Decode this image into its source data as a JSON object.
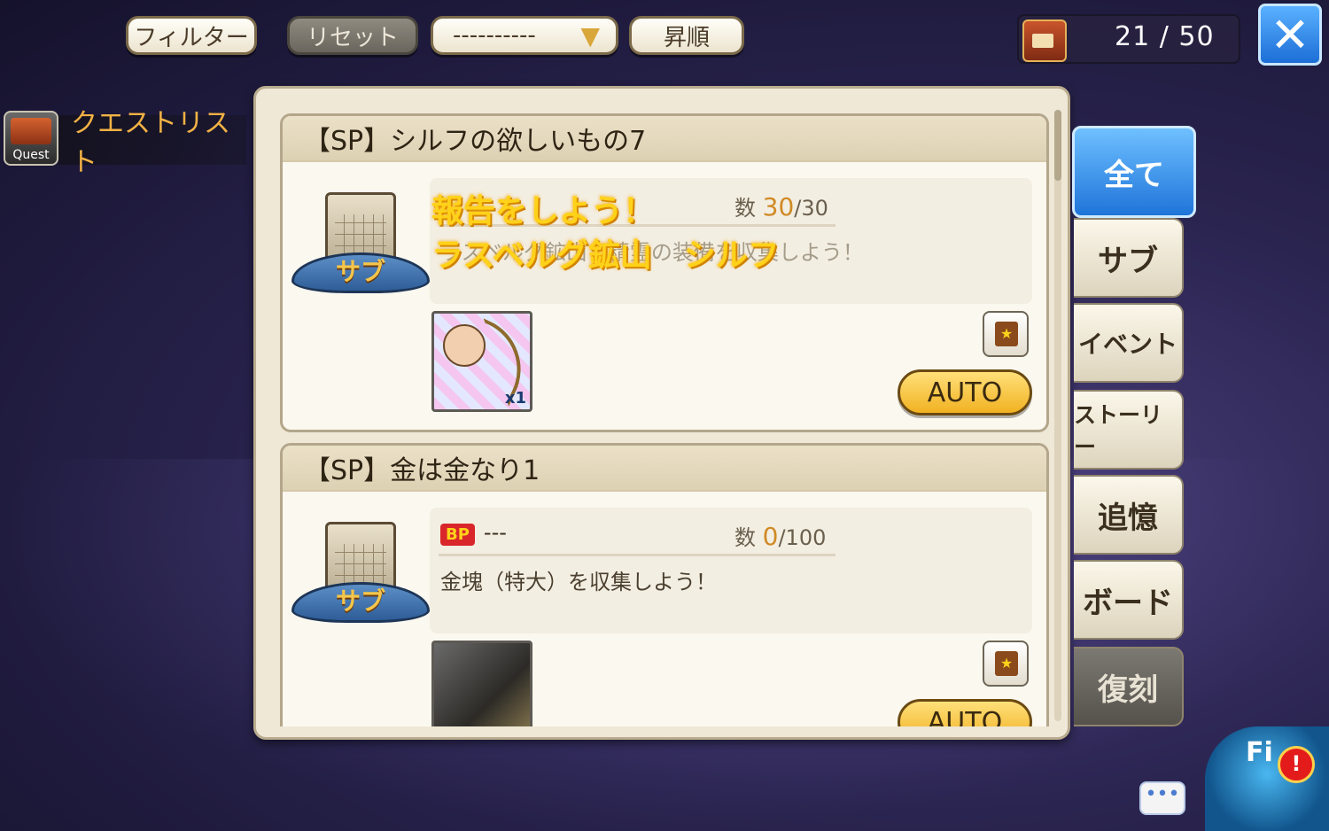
{
  "toolbar": {
    "filter_label": "フィルター",
    "reset_label": "リセット",
    "sort_select_value": "----------",
    "order_label": "昇順"
  },
  "counter": {
    "text": "21 / 50"
  },
  "close": {
    "glyph": "✕"
  },
  "sidebar": {
    "badge_text": "Quest",
    "title": "クエストリスト"
  },
  "quests": [
    {
      "title": "【SP】シルフの欲しいもの7",
      "emblem_label": "サブ",
      "info_title": "",
      "count_label": "数",
      "count_current": "30",
      "count_total": "/30",
      "description": "ラスベルグ鉱山で精霊の装備を収集しよう！",
      "overlay_line1": "報告をしよう！",
      "overlay_line2": "ラスベルグ鉱山　シルフ",
      "reward_qty": "x1",
      "auto_label": "AUTO"
    },
    {
      "title": "【SP】金は金なり1",
      "emblem_label": "サブ",
      "info_badge": "BP",
      "info_title": "---",
      "count_label": "数",
      "count_current": "0",
      "count_total": "/100",
      "description": "金塊（特大）を収集しよう！",
      "auto_label": "AUTO"
    }
  ],
  "tabs": [
    {
      "label": "全て",
      "state": "active"
    },
    {
      "label": "サブ",
      "state": "normal"
    },
    {
      "label": "イベント",
      "state": "normal"
    },
    {
      "label": "ストーリー",
      "state": "normal"
    },
    {
      "label": "追憶",
      "state": "normal"
    },
    {
      "label": "ボード",
      "state": "normal"
    },
    {
      "label": "復刻",
      "state": "dark"
    }
  ],
  "field": {
    "label": "Fi",
    "alert": "!"
  },
  "chat": {
    "glyph": "•••"
  },
  "colors": {
    "accent_blue": "#1f74d9",
    "gold": "#f1b221",
    "panel": "#efe8d6"
  }
}
